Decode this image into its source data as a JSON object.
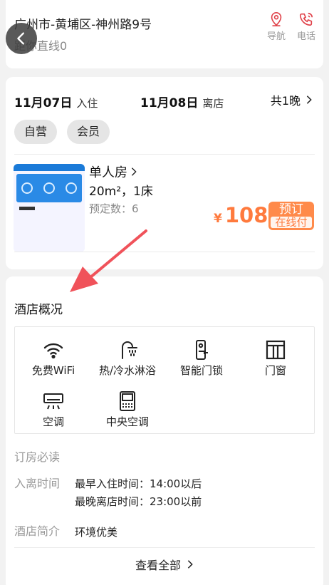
{
  "hotel": {
    "address": "广州市-黄埔区-神州路9号",
    "distance": "距你直线0",
    "nav_label": "导航",
    "phone_label": "电话"
  },
  "booking": {
    "checkin_date": "11月07日",
    "checkin_label": "入住",
    "checkout_date": "11月08日",
    "checkout_label": "离店",
    "nights": "共1晚",
    "tags": [
      "自营",
      "会员"
    ]
  },
  "room": {
    "name": "单人房",
    "spec": "20m²，1床",
    "booked": "预定数：6",
    "currency": "¥",
    "price": "108",
    "book_label": "预订",
    "book_sub": "在线付"
  },
  "overview": {
    "title": "酒店概况",
    "facilities": [
      {
        "label": "免费WiFi",
        "icon": "wifi-icon"
      },
      {
        "label": "热/冷水淋浴",
        "icon": "shower-icon"
      },
      {
        "label": "智能门锁",
        "icon": "smart-lock-icon"
      },
      {
        "label": "门窗",
        "icon": "window-icon"
      },
      {
        "label": "空调",
        "icon": "air-conditioner-icon"
      },
      {
        "label": "中央空调",
        "icon": "central-ac-icon"
      }
    ],
    "notice_title": "订房必读",
    "checkin_label": "入离时间",
    "earliest_checkin": "最早入住时间：14:00以后",
    "latest_checkout": "最晚离店时间：23:00以前",
    "intro_label": "酒店简介",
    "intro": "环境优美",
    "view_all": "查看全部"
  },
  "colors": {
    "accent": "#ff7a3d",
    "annotation_arrow": "#f0525a",
    "background": "#f2f2f2"
  }
}
